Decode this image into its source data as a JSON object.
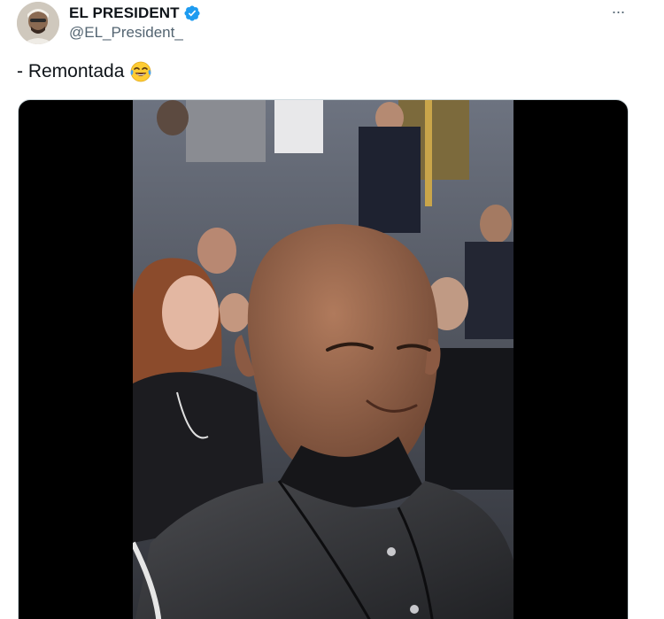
{
  "author": {
    "display_name": "EL PRESIDENT",
    "handle": "@EL_President_",
    "verified": true,
    "verified_color": "#1d9bf0"
  },
  "menu": {
    "more_label": "···"
  },
  "tweet": {
    "text": "- Remontada",
    "emoji": "face-with-tears-of-joy"
  },
  "media": {
    "type": "video",
    "background": "#000000"
  },
  "icons": {
    "verified": "verified-badge-icon",
    "more": "more-options-icon"
  }
}
